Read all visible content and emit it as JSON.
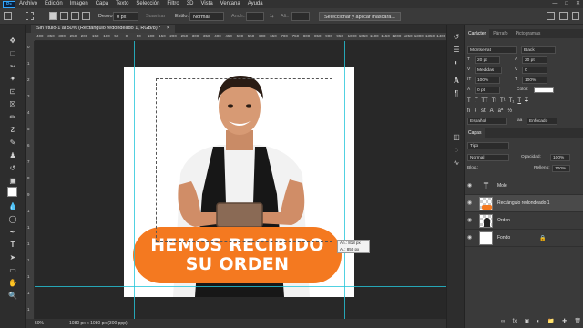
{
  "menu": {
    "logo": "Ps",
    "items": [
      "Archivo",
      "Edición",
      "Imagen",
      "Capa",
      "Texto",
      "Selección",
      "Filtro",
      "3D",
      "Vista",
      "Ventana",
      "Ayuda"
    ]
  },
  "options": {
    "feather_label": "Desvo:",
    "feather_value": "0 px",
    "smooth_label": "Suavizar",
    "style_label": "Estilo:",
    "style_value": "Normal",
    "width_label": "Anch.:",
    "height_label": "Alt.:",
    "select_mask_button": "Seleccionar y aplicar máscara..."
  },
  "document": {
    "tab_title": "Sin título-1 al 50% (Rectángulo redondeado 1, RGB/8) *",
    "close_glyph": "×"
  },
  "ruler": {
    "h_ticks": [
      "400",
      "350",
      "300",
      "250",
      "200",
      "150",
      "100",
      "50",
      "0",
      "50",
      "100",
      "150",
      "200",
      "250",
      "300",
      "350",
      "400",
      "450",
      "500",
      "550",
      "600",
      "650",
      "700",
      "750",
      "800",
      "850",
      "900",
      "950",
      "1000",
      "1050",
      "1100",
      "1150",
      "1200",
      "1250",
      "1300",
      "1350",
      "1400"
    ],
    "v_ticks": [
      "0",
      "1",
      "2",
      "3",
      "4",
      "5",
      "6",
      "7",
      "8",
      "9",
      "1",
      "1",
      "1",
      "1",
      "1",
      "1",
      "1"
    ]
  },
  "canvas": {
    "banner_line1": "HEMOS RECIBIDO",
    "banner_line2": "SU ORDEN",
    "tooltip_w": "An.: 818 px",
    "tooltip_h": "Al.: 850 px",
    "banner_color": "#f47920"
  },
  "status": {
    "zoom": "50%",
    "doc_info": "1080 px x 1080 px (300 ppp)"
  },
  "character_panel": {
    "tabs": [
      "Carácter",
      "Párrafo",
      "Pictogramas"
    ],
    "font_family": "Montserrat",
    "font_style": "Black",
    "font_size": "20 pt",
    "leading": "20 pt",
    "kerning": "Medidas",
    "tracking": "0",
    "vscale": "100%",
    "hscale": "100%",
    "baseline": "0 pt",
    "color_label": "Color:",
    "language": "Español",
    "antialias": "Enfocado"
  },
  "layers_panel": {
    "title": "Capas",
    "filter_label": "Tipo",
    "blend_mode": "Normal",
    "opacity_label": "Opacidad:",
    "opacity_value": "100%",
    "lock_label": "Bloq.:",
    "fill_label": "Relleno:",
    "fill_value": "100%",
    "layers": [
      {
        "name": "Mole",
        "type": "text"
      },
      {
        "name": "Rectángulo redondeado 1",
        "type": "shape"
      },
      {
        "name": "Orden",
        "type": "image"
      },
      {
        "name": "Fondo",
        "type": "background"
      }
    ]
  }
}
